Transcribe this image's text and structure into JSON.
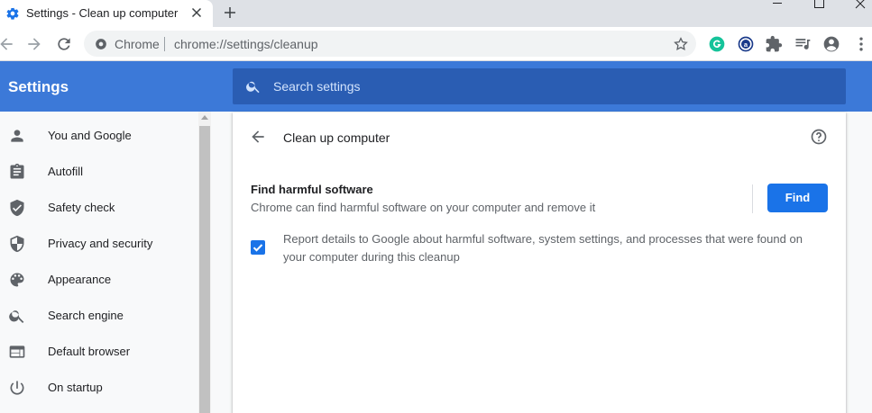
{
  "tab": {
    "title": "Settings - Clean up computer",
    "favicon": "gear-icon",
    "close_icon": "close-icon"
  },
  "new_tab_icon": "plus-icon",
  "window_controls": [
    "minimize-icon",
    "maximize-icon",
    "close-icon"
  ],
  "toolbar": {
    "back_icon": "back-arrow-icon",
    "forward_icon": "forward-arrow-icon",
    "reload_icon": "reload-icon",
    "omnibox": {
      "origin_label": "Chrome",
      "url": "chrome://settings/cleanup",
      "bookmark_icon": "star-icon"
    },
    "extensions": [
      "grammarly-icon",
      "extension-a-icon",
      "puzzle-icon",
      "reading-list-icon",
      "profile-icon",
      "menu-icon"
    ]
  },
  "header": {
    "title": "Settings",
    "search_placeholder": "Search settings"
  },
  "sidebar": {
    "items": [
      {
        "label": "You and Google",
        "icon": "person-icon"
      },
      {
        "label": "Autofill",
        "icon": "clipboard-icon"
      },
      {
        "label": "Safety check",
        "icon": "shield-check-icon"
      },
      {
        "label": "Privacy and security",
        "icon": "shield-half-icon"
      },
      {
        "label": "Appearance",
        "icon": "palette-icon"
      },
      {
        "label": "Search engine",
        "icon": "search-icon"
      },
      {
        "label": "Default browser",
        "icon": "browser-icon"
      },
      {
        "label": "On startup",
        "icon": "power-icon"
      }
    ]
  },
  "main": {
    "page_title": "Clean up computer",
    "find_title": "Find harmful software",
    "find_description": "Chrome can find harmful software on your computer and remove it",
    "find_button": "Find",
    "report_text": "Report details to Google about harmful software, system settings, and processes that were found on your computer during this cleanup",
    "report_checked": true
  },
  "colors": {
    "header_blue": "#3c79d8",
    "search_blue": "#2a5db3",
    "accent": "#1a73e8"
  }
}
